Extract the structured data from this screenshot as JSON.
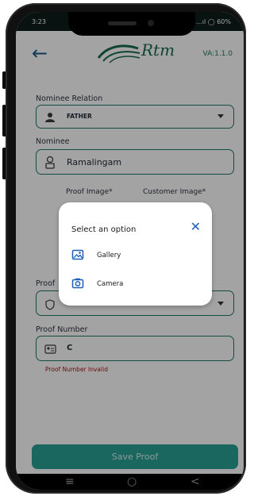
{
  "status_bar": {
    "time": "3:23",
    "indicators": "…ıl ◯ 60%"
  },
  "app": {
    "logo_text": "Rtm",
    "version": "VA:1.1.0"
  },
  "form": {
    "nominee_relation_label": "Nominee Relation",
    "nominee_relation_value": "FATHER",
    "nominee_label": "Nominee",
    "nominee_value": "Ramalingam",
    "proof_image_label": "Proof Image*",
    "customer_image_label": "Customer Image*",
    "proof_label": "Proof",
    "proof_number_label": "Proof Number",
    "proof_number_value": "C",
    "proof_number_error": "Proof Number Invalid",
    "save_button": "Save Proof"
  },
  "dialog": {
    "title": "Select an option",
    "options": [
      {
        "label": "Gallery",
        "icon": "gallery-icon"
      },
      {
        "label": "Camera",
        "icon": "camera-icon"
      }
    ]
  },
  "colors": {
    "accent": "#2aa197",
    "field_border": "#1f7a64",
    "error": "#b0121e",
    "dialog_icon": "#1f5fb8"
  }
}
